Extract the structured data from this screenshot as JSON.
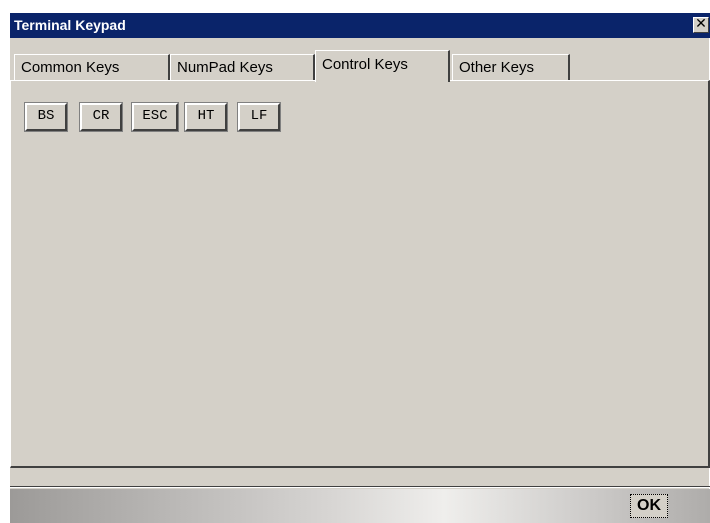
{
  "window": {
    "title": "Terminal Keypad",
    "close_glyph": "✕"
  },
  "tabs": [
    {
      "label": "Common Keys",
      "active": false
    },
    {
      "label": "NumPad Keys",
      "active": false
    },
    {
      "label": "Control Keys",
      "active": true
    },
    {
      "label": "Other Keys",
      "active": false
    }
  ],
  "keys": [
    "BS",
    "CR",
    "ESC",
    "HT",
    "LF"
  ],
  "footer": {
    "ok_label": "OK"
  },
  "colors": {
    "titlebar": "#0a246a",
    "face": "#d4d0c8"
  },
  "icons": {
    "close": "close-icon"
  }
}
